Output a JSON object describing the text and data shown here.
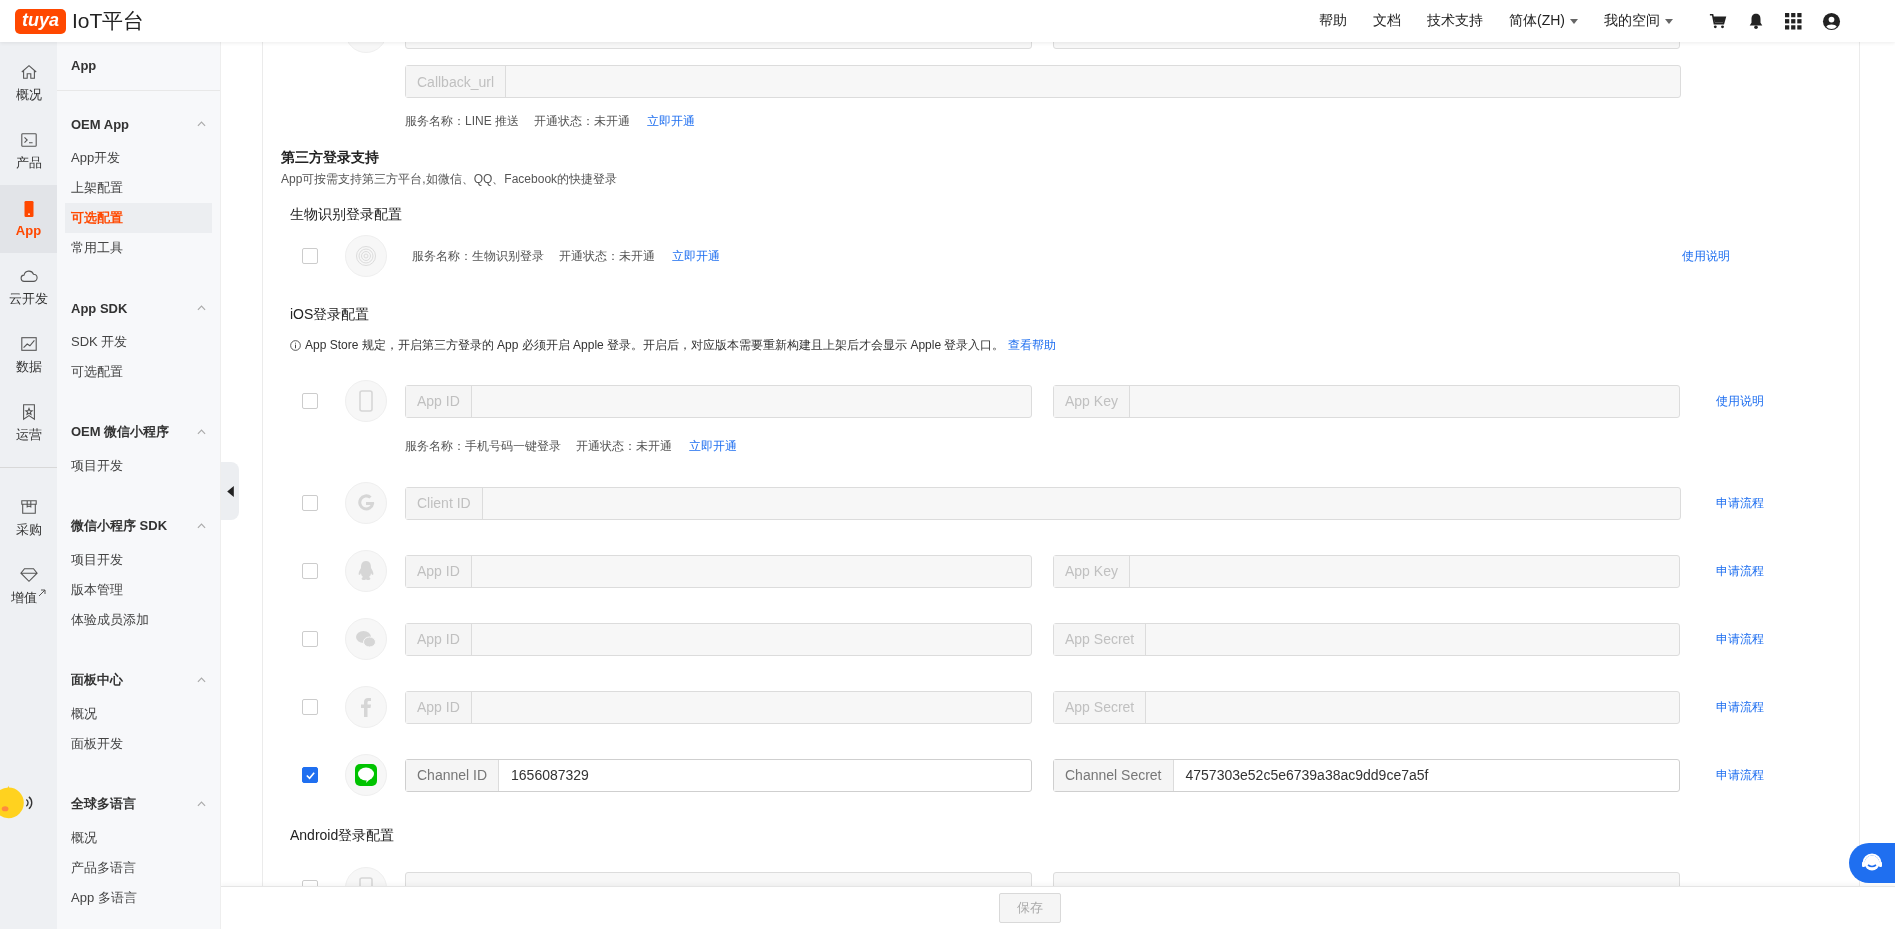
{
  "header": {
    "logo": "tuya",
    "title": "IoT平台",
    "nav": [
      {
        "label": "帮助",
        "dropdown": false
      },
      {
        "label": "文档",
        "dropdown": false
      },
      {
        "label": "技术支持",
        "dropdown": false
      },
      {
        "label": "简体(ZH)",
        "dropdown": true
      },
      {
        "label": "我的空间",
        "dropdown": true
      }
    ]
  },
  "rail": {
    "main": [
      {
        "label": "概况",
        "selected": false
      },
      {
        "label": "产品",
        "selected": false
      },
      {
        "label": "App",
        "selected": true
      },
      {
        "label": "云开发",
        "selected": false
      },
      {
        "label": "数据",
        "selected": false
      },
      {
        "label": "运营",
        "selected": false
      }
    ],
    "extra": [
      {
        "label": "采购",
        "selected": false,
        "external": false
      },
      {
        "label": "增值",
        "selected": false,
        "external": true
      }
    ]
  },
  "submenu": {
    "title": "App",
    "groups": [
      {
        "title": "OEM App",
        "expanded": true,
        "items": [
          {
            "label": "App开发",
            "selected": false
          },
          {
            "label": "上架配置",
            "selected": false
          },
          {
            "label": "可选配置",
            "selected": true
          },
          {
            "label": "常用工具",
            "selected": false
          }
        ]
      },
      {
        "title": "App SDK",
        "expanded": true,
        "items": [
          {
            "label": "SDK 开发",
            "selected": false
          },
          {
            "label": "可选配置",
            "selected": false
          }
        ]
      },
      {
        "title": "OEM 微信小程序",
        "expanded": true,
        "items": [
          {
            "label": "项目开发",
            "selected": false
          }
        ]
      },
      {
        "title": "微信小程序 SDK",
        "expanded": true,
        "items": [
          {
            "label": "项目开发",
            "selected": false
          },
          {
            "label": "版本管理",
            "selected": false
          },
          {
            "label": "体验成员添加",
            "selected": false
          }
        ]
      },
      {
        "title": "面板中心",
        "expanded": true,
        "items": [
          {
            "label": "概况",
            "selected": false
          },
          {
            "label": "面板开发",
            "selected": false
          }
        ]
      },
      {
        "title": "全球多语言",
        "expanded": true,
        "items": [
          {
            "label": "概况",
            "selected": false
          },
          {
            "label": "产品多语言",
            "selected": false
          },
          {
            "label": "App 多语言",
            "selected": false
          }
        ]
      }
    ]
  },
  "content": [
    {
      "kind": "cut_row"
    },
    {
      "kind": "extra_field",
      "field": {
        "label": "Callback_url"
      }
    },
    {
      "kind": "status",
      "service": "服务名称：LINE 推送",
      "state": "开通状态：未开通",
      "action": "立即开通"
    },
    {
      "kind": "title",
      "text": "第三方登录支持"
    },
    {
      "kind": "description",
      "text": "App可按需支持第三方平台,如微信、QQ、Facebook的快捷登录"
    },
    {
      "kind": "subtitle",
      "text": "生物识别登录配置"
    },
    {
      "kind": "service",
      "checked": false,
      "service": "服务名称：生物识别登录",
      "state": "开通状态：未开通",
      "action": "立即开通",
      "link": "使用说明"
    },
    {
      "kind": "subtitle",
      "text": "iOS登录配置"
    },
    {
      "kind": "notice",
      "text": "App Store 规定，开启第三方登录的 App 必须开启 Apple 登录。开启后，对应版本需要重新构建且上架后才会显示 Apple 登录入口。",
      "link": "查看帮助"
    },
    {
      "kind": "credentials",
      "checked": false,
      "fields": [
        {
          "label": "App ID"
        },
        {
          "label": "App Key"
        }
      ],
      "link": "使用说明"
    },
    {
      "kind": "status",
      "service": "服务名称：手机号码一键登录",
      "state": "开通状态：未开通",
      "action": "立即开通"
    },
    {
      "kind": "credentials",
      "checked": false,
      "fields": [
        {
          "label": "Client ID"
        }
      ],
      "link": "申请流程"
    },
    {
      "kind": "credentials",
      "checked": false,
      "fields": [
        {
          "label": "App ID"
        },
        {
          "label": "App Key"
        }
      ],
      "link": "申请流程"
    },
    {
      "kind": "credentials",
      "checked": false,
      "fields": [
        {
          "label": "App ID"
        },
        {
          "label": "App Secret"
        }
      ],
      "link": "申请流程"
    },
    {
      "kind": "credentials",
      "checked": false,
      "fields": [
        {
          "label": "App ID"
        },
        {
          "label": "App Secret"
        }
      ],
      "link": "申请流程"
    },
    {
      "kind": "credentials",
      "checked": true,
      "fields": [
        {
          "label": "Channel ID",
          "value": "1656087329"
        },
        {
          "label": "Channel Secret",
          "value": "4757303e52c5e6739a38ac9dd9ce7a5f"
        }
      ],
      "link": "申请流程"
    },
    {
      "kind": "subtitle",
      "text": "Android登录配置"
    },
    {
      "kind": "cut_row",
      "checked": false
    }
  ],
  "footer": {
    "save": {
      "label": "保存",
      "disabled": true
    }
  }
}
